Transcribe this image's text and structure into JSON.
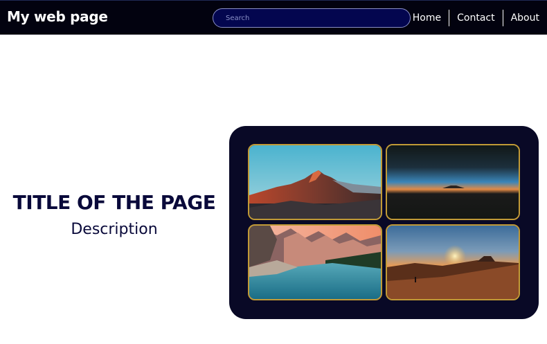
{
  "header": {
    "site_title": "My web page",
    "search": {
      "placeholder": "Search",
      "value": ""
    },
    "nav": [
      {
        "label": "Home"
      },
      {
        "label": "Contact"
      },
      {
        "label": "About"
      }
    ]
  },
  "hero": {
    "title": "TITLE OF THE PAGE",
    "description": "Description"
  },
  "colors": {
    "navbar_bg": "#02020f",
    "search_bg": "#03064f",
    "title_text": "#09093a",
    "gallery_bg": "#090926",
    "photo_border": "#c19a36"
  }
}
